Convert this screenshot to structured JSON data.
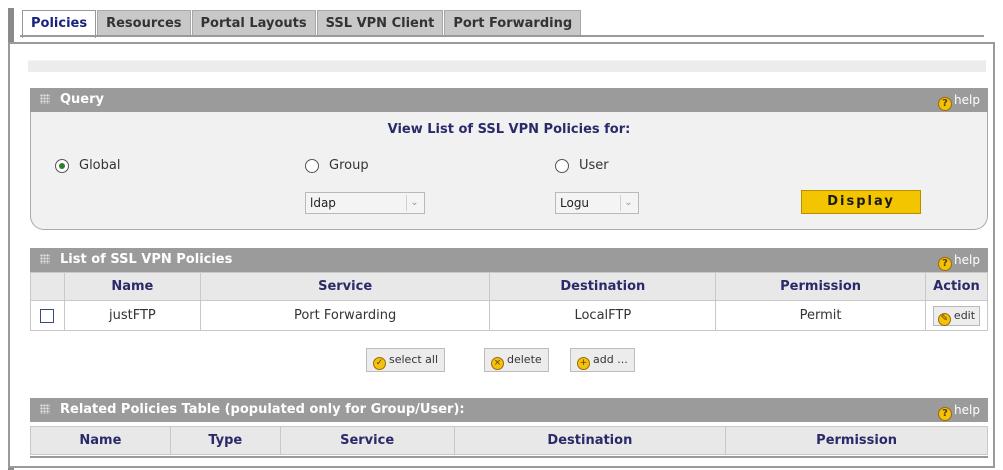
{
  "tabs": [
    {
      "label": "Policies",
      "active": true
    },
    {
      "label": "Resources",
      "active": false
    },
    {
      "label": "Portal Layouts",
      "active": false
    },
    {
      "label": "SSL VPN Client",
      "active": false
    },
    {
      "label": "Port Forwarding",
      "active": false
    }
  ],
  "query": {
    "header": "Query",
    "help": "help",
    "title": "View List of SSL VPN Policies for:",
    "options": {
      "global": "Global",
      "group": "Group",
      "user": "User"
    },
    "selected": "Global",
    "group_select": "ldap",
    "user_select": "Logu",
    "display_button": "Display"
  },
  "policies": {
    "header": "List of SSL VPN Policies",
    "help": "help",
    "columns": [
      "",
      "Name",
      "Service",
      "Destination",
      "Permission",
      "Action"
    ],
    "rows": [
      {
        "name": "justFTP",
        "service": "Port Forwarding",
        "destination": "LocalFTP",
        "permission": "Permit",
        "action": "edit"
      }
    ],
    "buttons": {
      "select_all": "select all",
      "delete": "delete",
      "add": "add ..."
    }
  },
  "related": {
    "header": "Related Policies Table (populated only for Group/User):",
    "help": "help",
    "columns": [
      "Name",
      "Type",
      "Service",
      "Destination",
      "Permission"
    ]
  },
  "colors": {
    "accent": "#f3c400",
    "header_gray": "#9b9b9b",
    "title_navy": "#2a2a6a"
  }
}
